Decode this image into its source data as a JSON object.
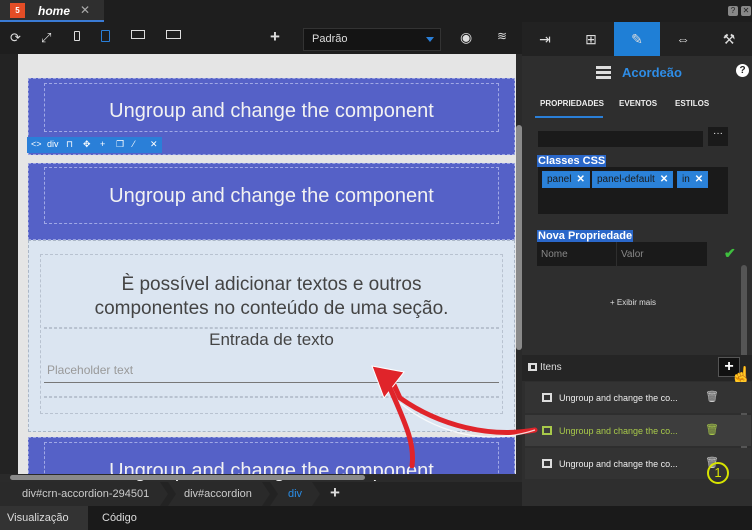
{
  "titlebar": {
    "file_tab": "home",
    "html5_badge": "5"
  },
  "toolbar": {
    "style_select": "Padrão"
  },
  "canvas": {
    "panel_title_1": "Ungroup and change the component",
    "panel_title_2": "Ungroup and change the component",
    "panel_title_3": "Ungroup and change the component",
    "selection_tag": "div",
    "body_line_1": "È possível adicionar textos e outros",
    "body_line_2": "componentes no conteúdo de uma seção.",
    "input_label": "Entrada de texto",
    "input_placeholder": "Placeholder text"
  },
  "breadcrumb": {
    "items": [
      "div#crn-accordion-294501",
      "div#accordion",
      "div"
    ]
  },
  "view_tabs": [
    "Visualização",
    "Código"
  ],
  "right_panel": {
    "component_title": "Acordeão",
    "subtabs": [
      "PROPRIEDADES",
      "EVENTOS",
      "ESTILOS"
    ],
    "css_classes_label": "Classes CSS",
    "css_classes": [
      "panel",
      "panel-default",
      "in"
    ],
    "new_property_label": "Nova Propriedade",
    "name_placeholder": "Nome",
    "value_placeholder": "Valor",
    "show_more": "+ Exibir mais",
    "items_label": "Itens",
    "items": [
      {
        "label": "Ungroup and change the co...",
        "selected": false
      },
      {
        "label": "Ungroup and change the co...",
        "selected": true
      },
      {
        "label": "Ungroup and change the co...",
        "selected": false
      }
    ],
    "step_number": "1"
  },
  "colors": {
    "accent": "#2a7fd8",
    "panel_heading": "#5561c7",
    "panel_body": "#dbe5f1",
    "selected_item_text": "#a8c94a",
    "annotation_arrow": "#e0242a",
    "step_marker": "#d7e400"
  }
}
